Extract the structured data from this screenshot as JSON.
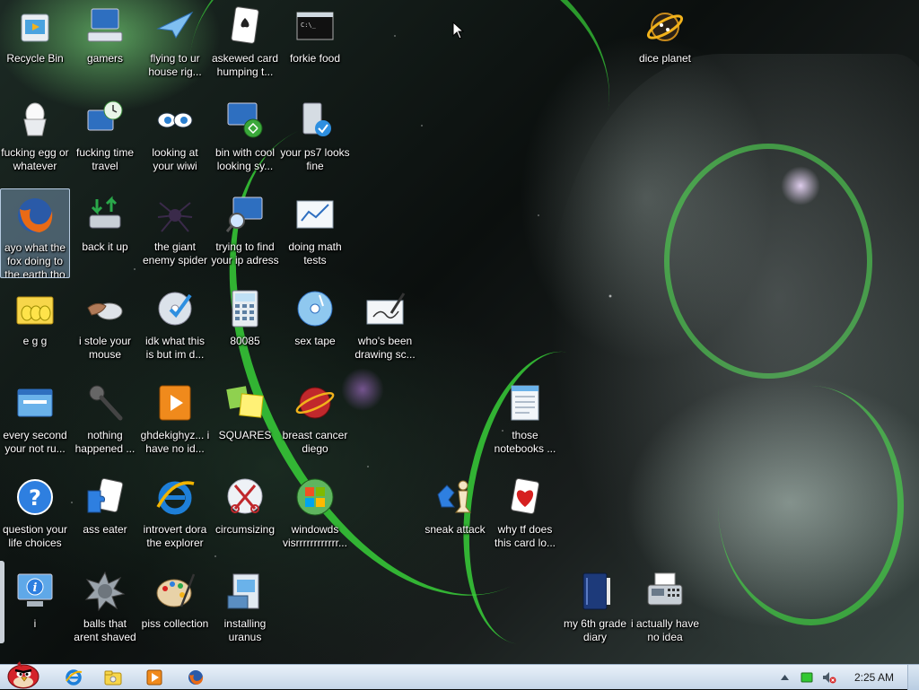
{
  "desktop": {
    "icons": [
      {
        "label": "Recycle Bin",
        "icon": "recycle-bin-icon"
      },
      {
        "label": "gamers",
        "icon": "computer-keyboard-icon"
      },
      {
        "label": "flying to ur house rig...",
        "icon": "paper-plane-icon"
      },
      {
        "label": "askewed card humping t...",
        "icon": "playing-card-icon"
      },
      {
        "label": "forkie food",
        "icon": "command-prompt-icon"
      },
      {
        "label": "dice planet",
        "icon": "dice-planet-icon"
      },
      {
        "label": "fucking egg or whatever",
        "icon": "egg-cup-icon"
      },
      {
        "label": "fucking time travel",
        "icon": "clock-computer-icon"
      },
      {
        "label": "looking at your wiwi",
        "icon": "eyes-icon"
      },
      {
        "label": "bin with cool looking sy...",
        "icon": "sync-computer-icon"
      },
      {
        "label": "your ps7 looks fine",
        "icon": "drive-check-icon"
      },
      {
        "label": "ayo what the fox doing to the earth tho",
        "icon": "firefox-icon"
      },
      {
        "label": "back it up",
        "icon": "backup-drive-icon"
      },
      {
        "label": "the giant enemy spider",
        "icon": "spider-icon"
      },
      {
        "label": "trying to find your ip adress",
        "icon": "magnifier-computer-icon"
      },
      {
        "label": "doing math tests",
        "icon": "math-chart-icon"
      },
      {
        "label": "e g g",
        "icon": "folder-eggs-icon"
      },
      {
        "label": "i stole your mouse",
        "icon": "mouse-hand-icon"
      },
      {
        "label": "idk what this is but im d...",
        "icon": "disc-check-icon"
      },
      {
        "label": "80085",
        "icon": "calculator-icon"
      },
      {
        "label": "sex tape",
        "icon": "media-disc-icon"
      },
      {
        "label": "who's been drawing sc...",
        "icon": "drawing-pen-icon"
      },
      {
        "label": "every second your not ru...",
        "icon": "window-icon"
      },
      {
        "label": "nothing happened ...",
        "icon": "microphone-icon"
      },
      {
        "label": "ghdekighyz... i have no id...",
        "icon": "media-player-icon"
      },
      {
        "label": "SQUARES",
        "icon": "sticky-notes-icon"
      },
      {
        "label": "breast cancer diego",
        "icon": "red-globe-icon"
      },
      {
        "label": "those notebooks ...",
        "icon": "notepad-icon"
      },
      {
        "label": "question your life choices",
        "icon": "help-icon"
      },
      {
        "label": "ass eater",
        "icon": "card-puzzle-icon"
      },
      {
        "label": "introvert dora the explorer",
        "icon": "internet-explorer-icon"
      },
      {
        "label": "circumsizing",
        "icon": "scissors-icon"
      },
      {
        "label": "windowds visrrrrrrrrrrrr...",
        "icon": "windows-logo-icon"
      },
      {
        "label": "sneak attack",
        "icon": "chess-pieces-icon"
      },
      {
        "label": "why tf does this card lo...",
        "icon": "heart-card-icon"
      },
      {
        "label": "i",
        "icon": "info-computer-icon"
      },
      {
        "label": "balls that arent shaved",
        "icon": "spiked-ball-icon"
      },
      {
        "label": "piss collection",
        "icon": "paint-palette-icon"
      },
      {
        "label": "installing uranus",
        "icon": "installer-icon"
      },
      {
        "label": "my 6th grade diary",
        "icon": "diary-book-icon"
      },
      {
        "label": "i actually have no idea",
        "icon": "fax-machine-icon"
      }
    ]
  },
  "taskbar": {
    "start_icon": "angry-bird-icon",
    "pinned": [
      {
        "icon": "internet-explorer-icon"
      },
      {
        "icon": "explorer-folder-icon"
      },
      {
        "icon": "media-player-icon"
      },
      {
        "icon": "firefox-icon"
      }
    ],
    "tray": {
      "show_hidden_icon": "up-arrow-icon",
      "network_icon": "network-battery-icon",
      "volume_icon": "volume-muted-icon",
      "clock": "2:25 AM"
    }
  },
  "colors": {
    "accent_green": "#3ce63c",
    "taskbar_top": "#e9f1f9",
    "taskbar_bottom": "#c5d6e8"
  }
}
